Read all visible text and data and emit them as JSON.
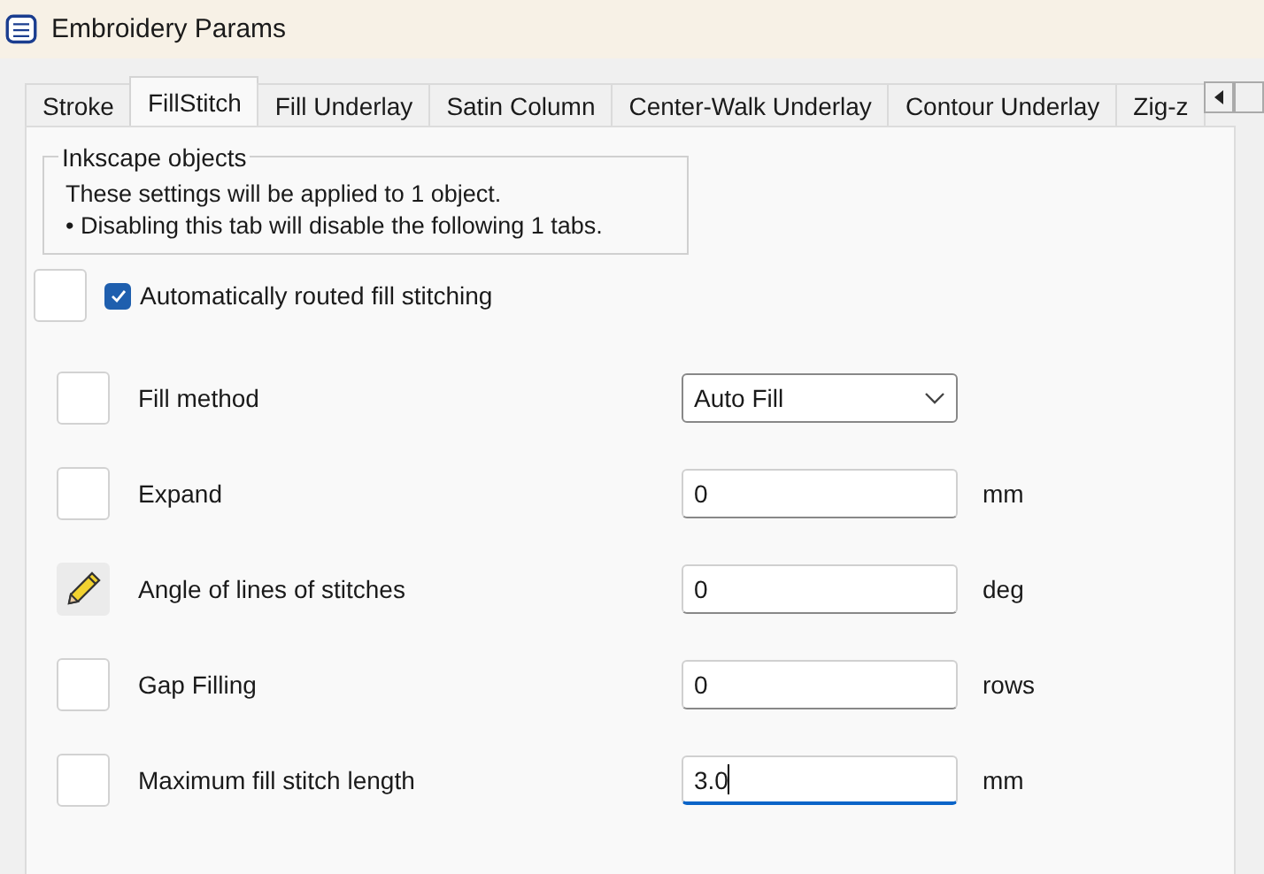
{
  "window": {
    "title": "Embroidery Params"
  },
  "tabs": [
    {
      "label": "Stroke",
      "selected": false
    },
    {
      "label": "FillStitch",
      "selected": true
    },
    {
      "label": "Fill Underlay",
      "selected": false
    },
    {
      "label": "Satin Column",
      "selected": false
    },
    {
      "label": "Center-Walk Underlay",
      "selected": false
    },
    {
      "label": "Contour Underlay",
      "selected": false
    },
    {
      "label": "Zig-z",
      "selected": false
    }
  ],
  "info_group": {
    "title": "Inkscape objects",
    "lines": [
      "These settings will be applied to 1 object.",
      "• Disabling this tab will disable the following 1 tabs."
    ]
  },
  "enable_checkbox": {
    "label": "Automatically routed fill stitching",
    "checked": true
  },
  "params": [
    {
      "label": "Fill method",
      "kind": "dropdown",
      "value": "Auto Fill",
      "edited": false,
      "focused": false
    },
    {
      "label": "Expand",
      "kind": "text",
      "value": "0",
      "unit": "mm",
      "edited": false,
      "focused": false
    },
    {
      "label": "Angle of lines of stitches",
      "kind": "text",
      "value": "0",
      "unit": "deg",
      "edited": true,
      "focused": false
    },
    {
      "label": "Gap Filling",
      "kind": "text",
      "value": "0",
      "unit": "rows",
      "edited": false,
      "focused": false
    },
    {
      "label": "Maximum fill stitch length",
      "kind": "text",
      "value": "3.0",
      "unit": "mm",
      "edited": false,
      "focused": true
    }
  ]
}
